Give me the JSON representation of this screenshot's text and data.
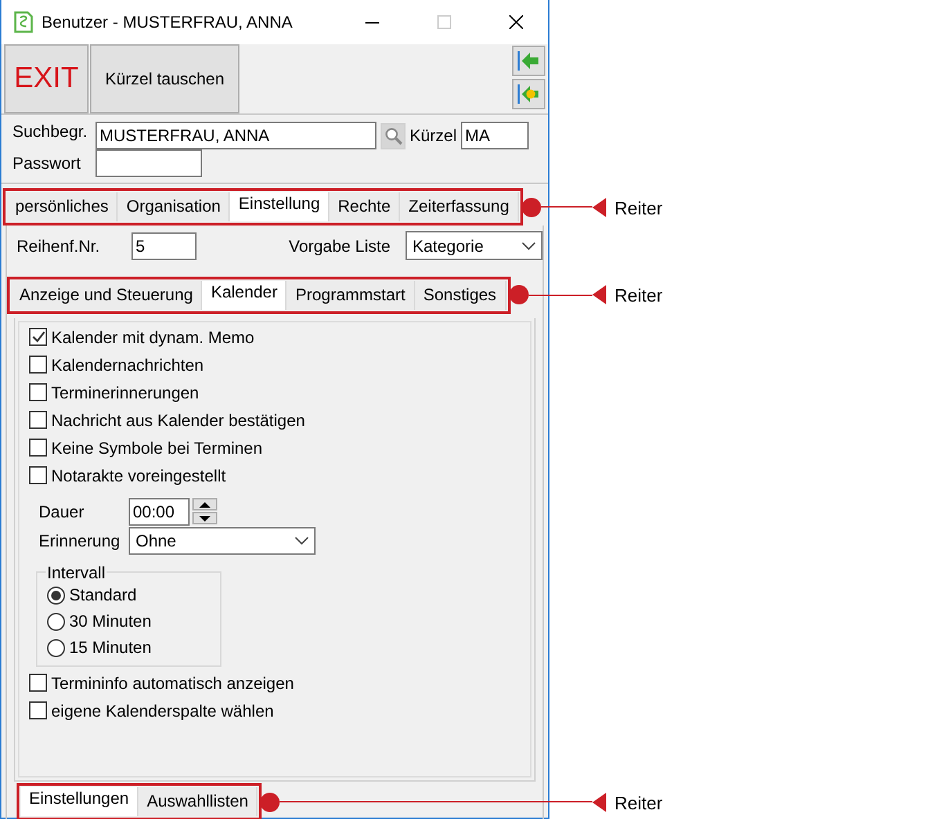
{
  "window": {
    "title": "Benutzer - MUSTERFRAU, ANNA"
  },
  "toolbar": {
    "buttons": [
      {
        "label": "EXIT",
        "kind": "exit"
      },
      {
        "label": "Kürzel tauschen",
        "kind": "plain"
      }
    ]
  },
  "search": {
    "label": "Suchbegr.",
    "value": "MUSTERFRAU, ANNA",
    "kuerzel_label": "Kürzel",
    "kuerzel_value": "MA",
    "password_label": "Passwort"
  },
  "main_tabs": [
    {
      "label": "persönliches",
      "selected": false
    },
    {
      "label": "Organisation",
      "selected": false
    },
    {
      "label": "Einstellung",
      "selected": true
    },
    {
      "label": "Rechte",
      "selected": false
    },
    {
      "label": "Zeiterfassung",
      "selected": false
    }
  ],
  "order": {
    "label": "Reihenf.Nr.",
    "value": "5",
    "list_label": "Vorgabe Liste",
    "list_value": "Kategorie"
  },
  "sub_tabs": [
    {
      "label": "Anzeige und Steuerung",
      "selected": false
    },
    {
      "label": "Kalender",
      "selected": true
    },
    {
      "label": "Programmstart",
      "selected": false
    },
    {
      "label": "Sonstiges",
      "selected": false
    }
  ],
  "options_top": [
    {
      "label": "Kalender mit dynam. Memo",
      "checked": true
    },
    {
      "label": "Kalendernachrichten",
      "checked": false
    },
    {
      "label": "Terminerinnerungen",
      "checked": false
    },
    {
      "label": "Nachricht aus Kalender bestätigen",
      "checked": false
    },
    {
      "label": "Keine Symbole bei Terminen",
      "checked": false
    },
    {
      "label": "Notarakte voreingestellt",
      "checked": false
    }
  ],
  "duration": {
    "label": "Dauer",
    "value": "00:00"
  },
  "reminder": {
    "label": "Erinnerung",
    "value": "Ohne"
  },
  "interval": {
    "title": "Intervall",
    "options": [
      {
        "label": "Standard",
        "selected": true
      },
      {
        "label": "30 Minuten",
        "selected": false
      },
      {
        "label": "15 Minuten",
        "selected": false
      }
    ]
  },
  "options_bottom": [
    {
      "label": "Termininfo automatisch anzeigen",
      "checked": false
    },
    {
      "label": "eigene Kalenderspalte wählen",
      "checked": false
    }
  ],
  "bottom_tabs": [
    {
      "label": "Einstellungen",
      "selected": true
    },
    {
      "label": "Auswahllisten",
      "selected": false
    }
  ],
  "annotations": [
    {
      "label": "Reiter"
    },
    {
      "label": "Reiter"
    },
    {
      "label": "Reiter"
    }
  ]
}
